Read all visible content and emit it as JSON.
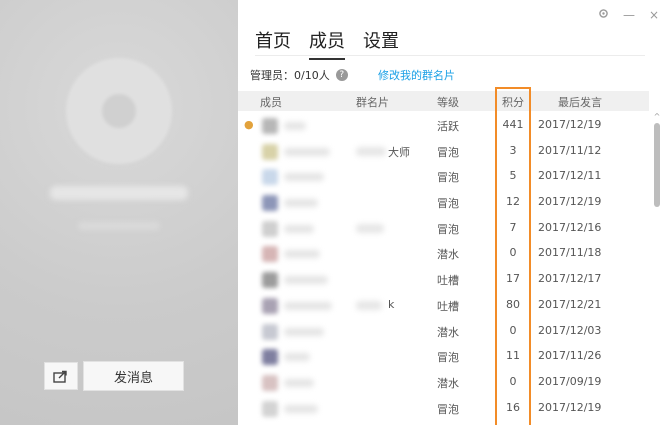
{
  "window": {
    "icons": [
      "settings-icon",
      "minimize-icon",
      "close-icon"
    ],
    "min_label": "—",
    "close_label": "×"
  },
  "tabs": [
    {
      "label": "首页",
      "active": false
    },
    {
      "label": "成员",
      "active": true
    },
    {
      "label": "设置",
      "active": false
    }
  ],
  "admin": {
    "label": "管理员：0/10人",
    "help_icon": "?",
    "edit_link": "修改我的群名片"
  },
  "columns": {
    "member": "成员",
    "card": "群名片",
    "level": "等级",
    "points": "积分",
    "last": "最后发言"
  },
  "members": [
    {
      "owner": true,
      "card_tail": "",
      "level": "活跃",
      "points": "441",
      "last": "2017/12/19"
    },
    {
      "owner": false,
      "card_tail": "大师",
      "level": "冒泡",
      "points": "3",
      "last": "2017/11/12"
    },
    {
      "owner": false,
      "card_tail": "",
      "level": "冒泡",
      "points": "5",
      "last": "2017/12/11"
    },
    {
      "owner": false,
      "card_tail": "",
      "level": "冒泡",
      "points": "12",
      "last": "2017/12/19"
    },
    {
      "owner": false,
      "card_tail": "",
      "level": "冒泡",
      "points": "7",
      "last": "2017/12/16"
    },
    {
      "owner": false,
      "card_tail": "",
      "level": "潜水",
      "points": "0",
      "last": "2017/11/18"
    },
    {
      "owner": false,
      "card_tail": "",
      "level": "吐槽",
      "points": "17",
      "last": "2017/12/17"
    },
    {
      "owner": false,
      "card_tail": "k",
      "level": "吐槽",
      "points": "80",
      "last": "2017/12/21"
    },
    {
      "owner": false,
      "card_tail": "",
      "level": "潜水",
      "points": "0",
      "last": "2017/12/03"
    },
    {
      "owner": false,
      "card_tail": "",
      "level": "冒泡",
      "points": "11",
      "last": "2017/11/26"
    },
    {
      "owner": false,
      "card_tail": "",
      "level": "潜水",
      "points": "0",
      "last": "2017/09/19"
    },
    {
      "owner": false,
      "card_tail": "",
      "level": "冒泡",
      "points": "16",
      "last": "2017/12/19"
    }
  ],
  "left": {
    "send_message": "发消息",
    "share_icon": "share-icon"
  },
  "colors": {
    "highlight": "#f28c28",
    "link": "#1aa0e6",
    "left_bg": "#cfcfcf"
  }
}
